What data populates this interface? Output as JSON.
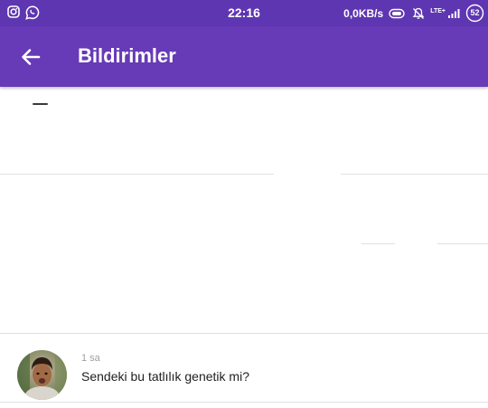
{
  "status_bar": {
    "time": "22:16",
    "network_speed": "0,0KB/s",
    "network_type": "LTE+",
    "battery": "52",
    "left_icons": [
      "instagram-icon",
      "whatsapp-icon"
    ],
    "right_icons": [
      "battery-saver-icon",
      "notifications-muted-icon",
      "signal-icon",
      "battery-icon"
    ]
  },
  "header": {
    "title": "Bildirimler",
    "back_icon": "arrow-left-icon"
  },
  "notifications": [
    {
      "time": "",
      "text": ""
    },
    {
      "time": "",
      "text": ""
    },
    {
      "time": "1 sa",
      "text": "Sendeki bu tatlılık genetik mi?"
    }
  ],
  "colors": {
    "status_bar": "#5e36b1",
    "app_bar": "#673ab7",
    "divider": "#e0e0e0",
    "secondary_text": "#9e9e9e",
    "primary_text": "#212121"
  }
}
